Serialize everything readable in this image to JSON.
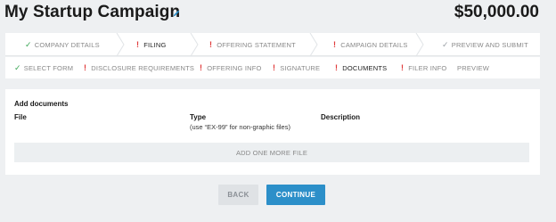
{
  "header": {
    "title": "My Startup Campaign",
    "amount": "$50,000.00"
  },
  "steps": [
    {
      "label": "COMPANY DETAILS",
      "status": "done"
    },
    {
      "label": "FILING",
      "status": "warning",
      "active": true
    },
    {
      "label": "OFFERING STATEMENT",
      "status": "warning"
    },
    {
      "label": "CAMPAIGN DETAILS",
      "status": "warning"
    },
    {
      "label": "PREVIEW AND SUBMIT",
      "status": "pending"
    }
  ],
  "substeps": [
    {
      "label": "SELECT FORM",
      "status": "done"
    },
    {
      "label": "DISCLOSURE REQUIREMENTS",
      "status": "warning"
    },
    {
      "label": "OFFERING INFO",
      "status": "warning"
    },
    {
      "label": "SIGNATURE",
      "status": "warning"
    },
    {
      "label": "DOCUMENTS",
      "status": "warning",
      "active": true
    },
    {
      "label": "FILER INFO",
      "status": "warning"
    },
    {
      "label": "PREVIEW",
      "status": "none"
    }
  ],
  "documents": {
    "title": "Add documents",
    "columns": {
      "file": "File",
      "type": "Type",
      "type_note": "(use “EX-99” for non-graphic files)",
      "description": "Description"
    },
    "add_button": "ADD ONE MORE FILE"
  },
  "actions": {
    "back": "BACK",
    "continue": "CONTINUE"
  },
  "colors": {
    "accent": "#2c8fc9",
    "success": "#3aa655",
    "warning": "#e03b3b"
  }
}
